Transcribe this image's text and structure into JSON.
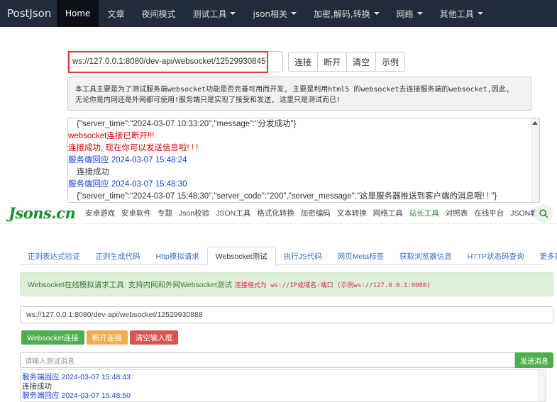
{
  "top": {
    "brand": "PostJson",
    "nav": [
      {
        "label": "Home",
        "active": true,
        "dropdown": false
      },
      {
        "label": "文章",
        "active": false,
        "dropdown": false
      },
      {
        "label": "夜间模式",
        "active": false,
        "dropdown": false
      },
      {
        "label": "测试工具",
        "active": false,
        "dropdown": true
      },
      {
        "label": "json相关",
        "active": false,
        "dropdown": true
      },
      {
        "label": "加密,解码,转换",
        "active": false,
        "dropdown": true
      },
      {
        "label": "网络",
        "active": false,
        "dropdown": true
      },
      {
        "label": "其他工具",
        "active": false,
        "dropdown": true
      }
    ],
    "url_value": "ws://127.0.0.1:8080/dev-api/websocket/12529930845",
    "buttons": [
      "连接",
      "断开",
      "清空",
      "示例"
    ],
    "info_line1": "本工具主要是为了测试服务端websocket功能是否完善可用而开发, 主要是利用html5 的websocket去连接服务端的websocket,因此,",
    "info_line2": "无论你是内网还是外网都可使用!服务端只是实现了接受和发送, 这里只是测试而已!",
    "log": [
      {
        "type": "black",
        "text": "{\"server_time\":\"2024-03-07 10:33:20\",\"message\":\"分发成功\"}"
      },
      {
        "type": "red",
        "text": "websocket连接已断开!!!"
      },
      {
        "type": "red",
        "text": "连接成功, 现在你可以发送信息啦! ! !"
      },
      {
        "type": "blue",
        "text": "服务端回应 2024-03-07 15:48:24"
      },
      {
        "type": "indent",
        "text": "连接成功"
      },
      {
        "type": "blue",
        "text": "服务端回应 2024-03-07 15:48:30"
      },
      {
        "type": "black",
        "text": "{\"server_time\":\"2024-03-07 15:48:30\",\"server_code\":\"200\",\"server_message\":\"这是服务器推送到客户端的消息哦! ! \"}"
      }
    ]
  },
  "bottom": {
    "logo": "Jsons.cn",
    "nav": [
      {
        "label": "安卓游戏",
        "green": false
      },
      {
        "label": "安卓软件",
        "green": false
      },
      {
        "label": "专题",
        "green": false
      },
      {
        "label": "Json校验",
        "green": false
      },
      {
        "label": "JSON工具",
        "green": false
      },
      {
        "label": "格式化转换",
        "green": false
      },
      {
        "label": "加密编码",
        "green": false
      },
      {
        "label": "文本转换",
        "green": false
      },
      {
        "label": "网络工具",
        "green": false
      },
      {
        "label": "站长工具",
        "green": true
      },
      {
        "label": "对照表",
        "green": false
      },
      {
        "label": "在线平台",
        "green": false
      },
      {
        "label": "JSON教程",
        "green": false
      }
    ],
    "tabs": [
      {
        "label": "正则表达式验证",
        "active": false
      },
      {
        "label": "正则生成代码",
        "active": false
      },
      {
        "label": "Http模拟请求",
        "active": false
      },
      {
        "label": "Websocket测试",
        "active": true
      },
      {
        "label": "执行JS代码",
        "active": false
      },
      {
        "label": "网页Meta标签",
        "active": false
      },
      {
        "label": "获取浏览器信息",
        "active": false
      },
      {
        "label": "HTTP状态码查询",
        "active": false
      },
      {
        "label": "更多开发工具",
        "active": false
      }
    ],
    "alert_text": "Websocket在线模拟请求工具: 支持内网和外网Websocket测试",
    "alert_hint": "连接格式为 ws://IP或域名:端口 (示例ws://127.0.0.1:8080)",
    "url_value": "ws://127.0.0.1:8080/dev-api/websocket/12529930888",
    "btn_connect": "Websocket连接",
    "btn_disconnect": "断开连接",
    "btn_clear": "清空输入框",
    "msg_placeholder": "请输入测试消息",
    "send_label": "发送消息",
    "log": [
      {
        "type": "blue",
        "text": "服务端回应 2024-03-07 15:48:43"
      },
      {
        "type": "black",
        "text": "连接成功"
      },
      {
        "type": "blue",
        "text": "服务端回应 2024-03-07 15:48:50"
      }
    ]
  }
}
